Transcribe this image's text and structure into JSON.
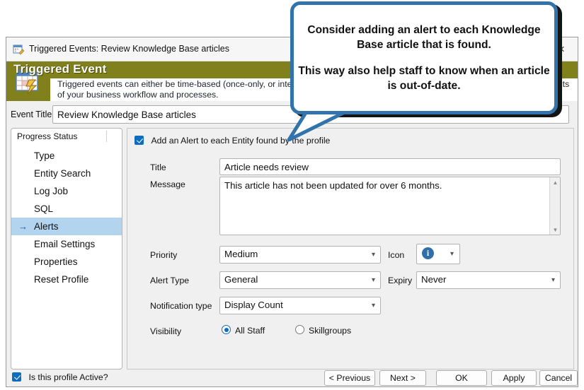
{
  "window": {
    "title": "Triggered Events: Review Knowledge Base articles",
    "title_icon": "calendar-edit-icon",
    "close_icon": "×"
  },
  "banner": {
    "heading": "Triggered Event",
    "description": "Triggered events can either be time-based (once-only, or interval) or event-driven. Use Triggered Events to automate various aspects of your business workflow and processes.",
    "icon": "calendar-lightning-icon",
    "color": "#80801c"
  },
  "event_title": {
    "label": "Event Title",
    "value": "Review Knowledge Base articles",
    "placeholder": "Event Title"
  },
  "sidebar": {
    "header": "Progress Status",
    "items": [
      {
        "label": "Type",
        "selected": false
      },
      {
        "label": "Entity Search",
        "selected": false
      },
      {
        "label": "Log Job",
        "selected": false
      },
      {
        "label": "SQL",
        "selected": false
      },
      {
        "label": "Alerts",
        "selected": true
      },
      {
        "label": "Email Settings",
        "selected": false
      },
      {
        "label": "Properties",
        "selected": false
      },
      {
        "label": "Reset Profile",
        "selected": false
      }
    ],
    "selection_arrow": "→",
    "highlight_color": "#b3d4ef"
  },
  "panel": {
    "add_alert_checkbox": {
      "label": "Add an Alert to each Entity found by the profile",
      "checked": true
    },
    "fields": {
      "title_label": "Title",
      "title_value": "Article needs review",
      "message_label": "Message",
      "message_value": "This article has not been updated for over 6 months.",
      "priority_label": "Priority",
      "priority_value": "Medium",
      "icon_label": "Icon",
      "icon_value": "info-icon",
      "alert_type_label": "Alert Type",
      "alert_type_value": "General",
      "expiry_label": "Expiry",
      "expiry_value": "Never",
      "notification_type_label": "Notification type",
      "notification_type_value": "Display Count",
      "visibility_label": "Visibility",
      "visibility_options": [
        {
          "label": "All Staff",
          "selected": true
        },
        {
          "label": "Skillgroups",
          "selected": false
        }
      ]
    }
  },
  "footer": {
    "active_checkbox": {
      "label": "Is this profile Active?",
      "checked": true
    },
    "buttons": [
      {
        "name": "previous",
        "label": "< Previous"
      },
      {
        "name": "next",
        "label": "Next >"
      },
      {
        "name": "ok",
        "label": "OK"
      },
      {
        "name": "apply",
        "label": "Apply"
      },
      {
        "name": "cancel",
        "label": "Cancel"
      }
    ]
  },
  "callout": {
    "line1": "Consider adding an alert to each Knowledge Base article that is found.",
    "line2": "This way also help staff to know when an article is out-of-date.",
    "border_color": "#3273ab"
  }
}
